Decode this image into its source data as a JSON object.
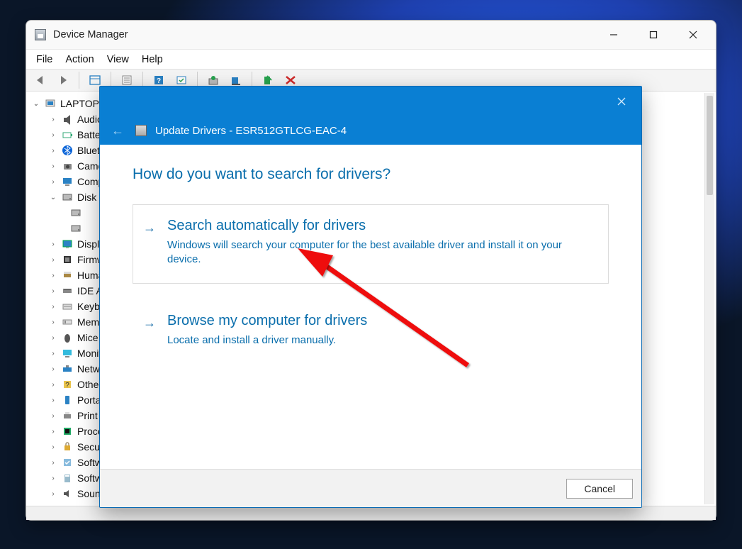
{
  "dm": {
    "title": "Device Manager",
    "menu": [
      "File",
      "Action",
      "View",
      "Help"
    ],
    "root": "LAPTOP",
    "nodes": [
      {
        "label": "Audio",
        "icon": "audio"
      },
      {
        "label": "Batteries",
        "icon": "battery"
      },
      {
        "label": "Bluetooth",
        "icon": "bluetooth"
      },
      {
        "label": "Cameras",
        "icon": "camera"
      },
      {
        "label": "Computer",
        "icon": "monitor"
      },
      {
        "label": "Disk drives",
        "icon": "disk",
        "expanded": true
      },
      {
        "label": "Display adapters",
        "icon": "display"
      },
      {
        "label": "Firmware",
        "icon": "firmware"
      },
      {
        "label": "Human Interface Devices",
        "icon": "hid"
      },
      {
        "label": "IDE ATA/ATAPI controllers",
        "icon": "ide"
      },
      {
        "label": "Keyboards",
        "icon": "keyboard"
      },
      {
        "label": "Memory technology devices",
        "icon": "memory"
      },
      {
        "label": "Mice and other pointing devices",
        "icon": "mouse"
      },
      {
        "label": "Monitors",
        "icon": "monitor2"
      },
      {
        "label": "Network adapters",
        "icon": "network"
      },
      {
        "label": "Other devices",
        "icon": "other"
      },
      {
        "label": "Portable Devices",
        "icon": "portable"
      },
      {
        "label": "Print queues",
        "icon": "print"
      },
      {
        "label": "Processors",
        "icon": "cpu"
      },
      {
        "label": "Security devices",
        "icon": "security"
      },
      {
        "label": "Software components",
        "icon": "softcomp"
      },
      {
        "label": "Software devices",
        "icon": "softdev"
      },
      {
        "label": "Sound, video and game controllers",
        "icon": "sound"
      }
    ]
  },
  "dlg": {
    "title": "Update Drivers - ESR512GTLCG-EAC-4",
    "question": "How do you want to search for drivers?",
    "opt1": {
      "title": "Search automatically for drivers",
      "desc": "Windows will search your computer for the best available driver and install it on your device."
    },
    "opt2": {
      "title": "Browse my computer for drivers",
      "desc": "Locate and install a driver manually."
    },
    "cancel": "Cancel"
  }
}
